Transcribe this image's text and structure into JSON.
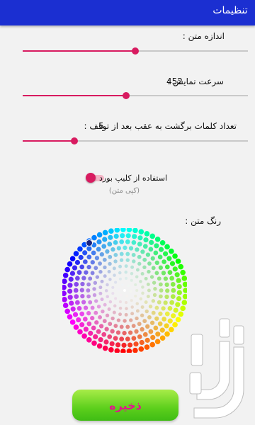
{
  "app_bar": {
    "title": "تنظیمات"
  },
  "settings": {
    "text_size": {
      "label": "اندازه متن :",
      "value_fraction": 0.5
    },
    "display_speed": {
      "label": "سرعت نمایش :",
      "value": "452",
      "value_fraction": 0.46
    },
    "back_words": {
      "label": "تعداد کلمات برگشت به عقب بعد از توقف :",
      "value": "5",
      "value_fraction": 0.23
    },
    "clipboard": {
      "label": "استفاده از کلیپ بورد",
      "sub_label": "(کپی متن)",
      "enabled": false
    },
    "text_color": {
      "label": "رنگ متن :",
      "selected_color": "#1a237e"
    }
  },
  "save_button": {
    "label": "ذخیره"
  },
  "colors": {
    "accent": "#d81b60",
    "app_bar": "#1b2fd1",
    "save_green": "#5ccf1c",
    "save_text": "#e0188b"
  },
  "icons": {
    "logo": "bazaar-logo-icon",
    "color_wheel": "color-wheel-icon"
  }
}
